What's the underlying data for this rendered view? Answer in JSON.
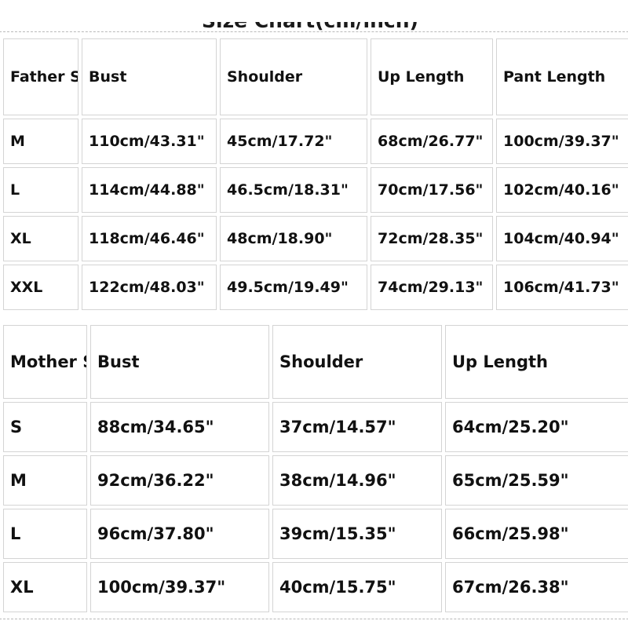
{
  "page": {
    "background_color": "#ffffff",
    "outer_border_color": "#b9b9b9",
    "cell_border_color": "#d4d4d4",
    "text_color": "#111111",
    "clipped_heading": "Size Chart(cm/inch)"
  },
  "father_table": {
    "name": "father-size-chart",
    "headers": [
      "Father Size",
      "Bust",
      "Shoulder",
      "Up Length",
      "Pant Length"
    ],
    "rows": [
      {
        "size": "M",
        "bust": "110cm/43.31\"",
        "shoulder": "45cm/17.72\"",
        "up_length": "68cm/26.77\"",
        "pant_length": "100cm/39.37\""
      },
      {
        "size": "L",
        "bust": "114cm/44.88\"",
        "shoulder": "46.5cm/18.31\"",
        "up_length": "70cm/17.56\"",
        "pant_length": "102cm/40.16\""
      },
      {
        "size": "XL",
        "bust": "118cm/46.46\"",
        "shoulder": "48cm/18.90\"",
        "up_length": "72cm/28.35\"",
        "pant_length": "104cm/40.94\""
      },
      {
        "size": "XXL",
        "bust": "122cm/48.03\"",
        "shoulder": "49.5cm/19.49\"",
        "up_length": "74cm/29.13\"",
        "pant_length": "106cm/41.73\""
      }
    ]
  },
  "mother_table": {
    "name": "mother-size-chart",
    "headers": [
      "Mother Size",
      "Bust",
      "Shoulder",
      "Up Length"
    ],
    "rows": [
      {
        "size": "S",
        "bust": "88cm/34.65\"",
        "shoulder": "37cm/14.57\"",
        "up_length": "64cm/25.20\""
      },
      {
        "size": "M",
        "bust": "92cm/36.22\"",
        "shoulder": "38cm/14.96\"",
        "up_length": "65cm/25.59\""
      },
      {
        "size": "L",
        "bust": "96cm/37.80\"",
        "shoulder": "39cm/15.35\"",
        "up_length": "66cm/25.98\""
      },
      {
        "size": "XL",
        "bust": "100cm/39.37\"",
        "shoulder": "40cm/15.75\"",
        "up_length": "67cm/26.38\""
      }
    ]
  }
}
